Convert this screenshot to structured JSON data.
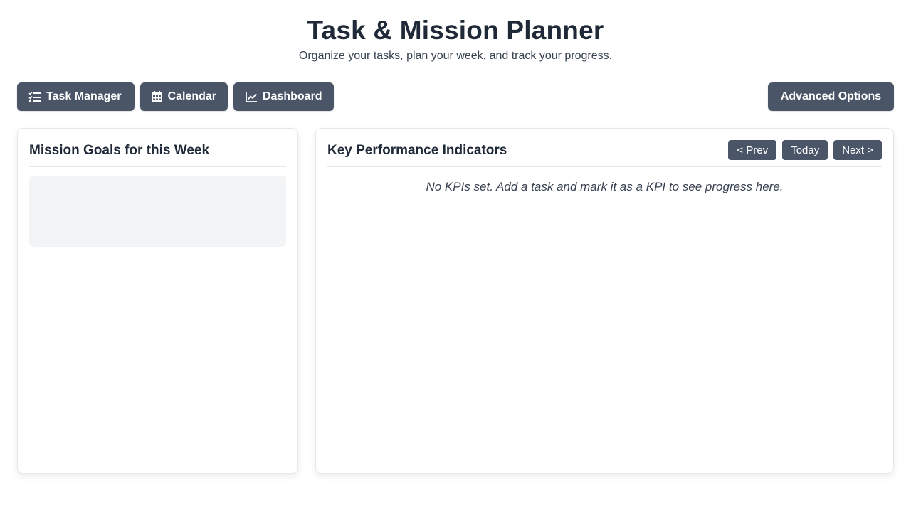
{
  "header": {
    "title": "Task & Mission Planner",
    "subtitle": "Organize your tasks, plan your week, and track your progress."
  },
  "nav": {
    "task_manager": {
      "label": "Task Manager",
      "icon": "checklist-icon"
    },
    "calendar": {
      "label": "Calendar",
      "icon": "calendar-icon"
    },
    "dashboard": {
      "label": "Dashboard",
      "icon": "chart-line-icon"
    },
    "advanced_options": {
      "label": "Advanced Options"
    }
  },
  "goals_panel": {
    "title": "Mission Goals for this Week"
  },
  "kpi_panel": {
    "title": "Key Performance Indicators",
    "prev_label": "< Prev",
    "today_label": "Today",
    "next_label": "Next >",
    "empty_message": "No KPIs set. Add a task and mark it as a KPI to see progress here."
  },
  "colors": {
    "button_bg": "#4a5567",
    "button_text": "#ffffff",
    "title_text": "#1f2937",
    "goals_box_bg": "#f3f4f6"
  }
}
